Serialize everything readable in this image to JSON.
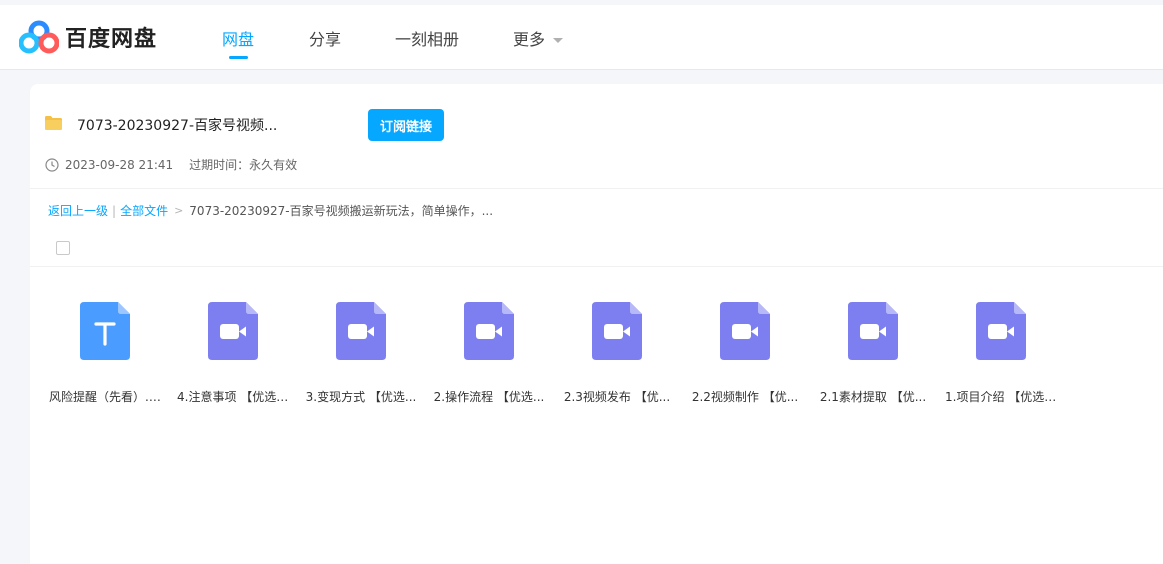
{
  "app": {
    "brand": "百度网盘"
  },
  "nav": {
    "items": [
      {
        "label": "网盘",
        "active": true
      },
      {
        "label": "分享",
        "active": false
      },
      {
        "label": "一刻相册",
        "active": false
      },
      {
        "label": "更多",
        "active": false
      }
    ]
  },
  "share": {
    "title": "7073-20230927-百家号视频...",
    "subscribe_label": "订阅链接",
    "date": "2023-09-28 21:41",
    "expire": "过期时间：永久有效"
  },
  "breadcrumb": {
    "back": "返回上一级",
    "sep": "|",
    "all": "全部文件",
    "arrow": ">",
    "current": "7073-20230927-百家号视频搬运新玩法，简单操作，..."
  },
  "files": [
    {
      "name": "风险提醒（先看）.txt",
      "type": "txt"
    },
    {
      "name": "4.注意事项 【优选 ...",
      "type": "video"
    },
    {
      "name": "3.变现方式 【优选...",
      "type": "video"
    },
    {
      "name": "2.操作流程 【优选...",
      "type": "video"
    },
    {
      "name": "2.3视频发布 【优...",
      "type": "video"
    },
    {
      "name": "2.2视频制作 【优...",
      "type": "video"
    },
    {
      "name": "2.1素材提取 【优...",
      "type": "video"
    },
    {
      "name": "1.项目介绍 【优选 ...",
      "type": "video"
    }
  ],
  "colors": {
    "accent": "#06a7ff",
    "txt_icon": "#4b9cff",
    "video_icon": "#7d7ff0",
    "folder": "#f4c048"
  }
}
